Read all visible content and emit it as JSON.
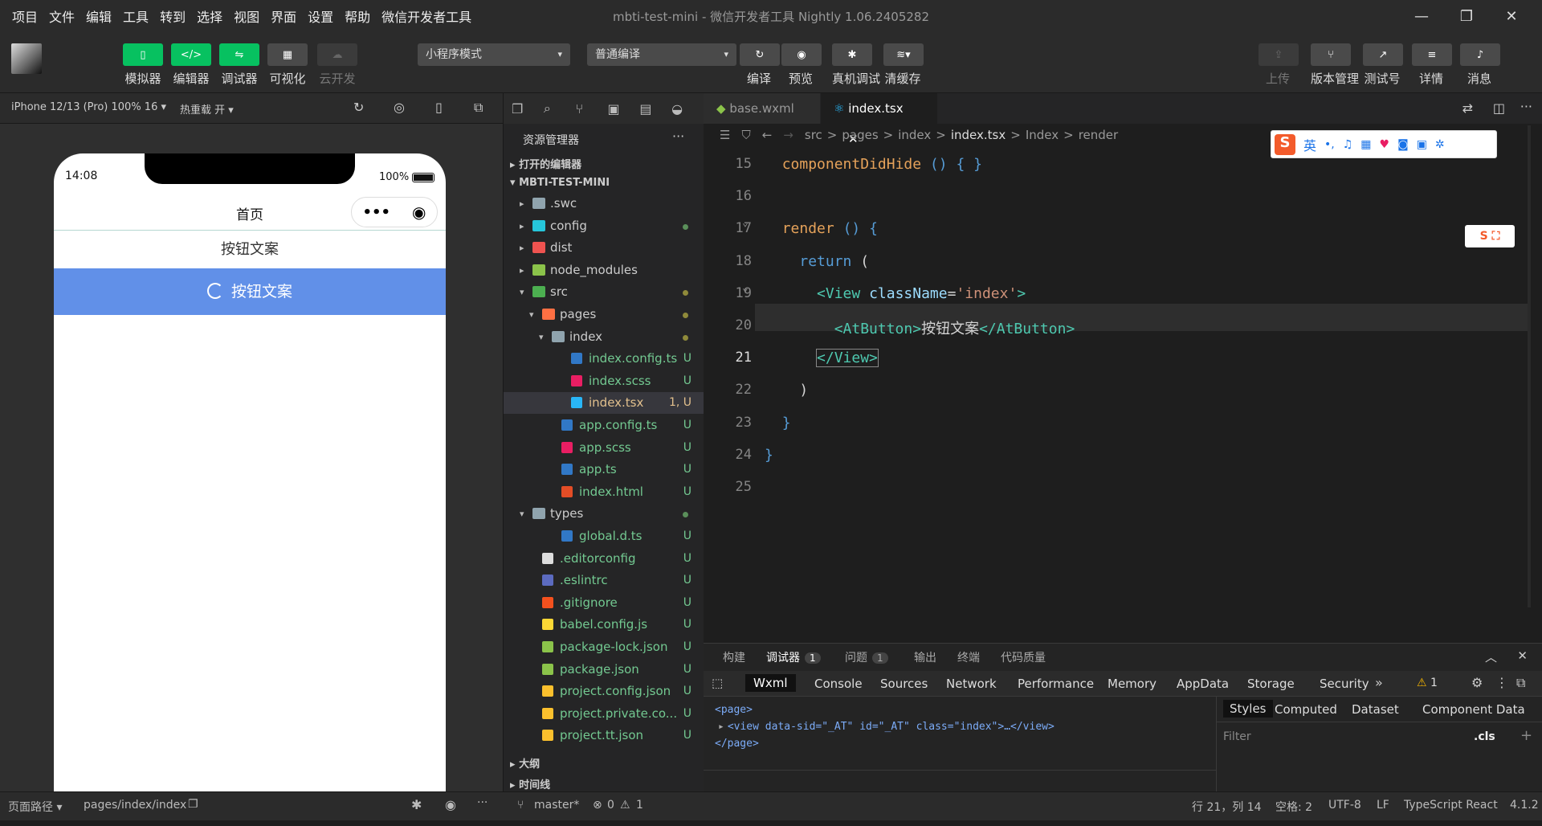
{
  "menu": [
    "项目",
    "文件",
    "编辑",
    "工具",
    "转到",
    "选择",
    "视图",
    "界面",
    "设置",
    "帮助",
    "微信开发者工具"
  ],
  "window_title": "mbti-test-mini - 微信开发者工具 Nightly 1.06.2405282",
  "toolbar": {
    "simulator": "模拟器",
    "editor": "编辑器",
    "debugger": "调试器",
    "visual": "可视化",
    "cloud": "云开发",
    "mode": "小程序模式",
    "compile_mode": "普通编译",
    "compile": "编译",
    "preview": "预览",
    "real_debug": "真机调试",
    "clear_cache": "清缓存",
    "upload": "上传",
    "version": "版本管理",
    "test": "测试号",
    "detail": "详情",
    "message": "消息"
  },
  "sim": {
    "device": "iPhone 12/13 (Pro) 100% 16 ▾",
    "hot_reload": "热重载 开 ▾",
    "time": "14:08",
    "battery": "100%",
    "nav_title": "首页",
    "text_btn": "按钮文案",
    "primary_btn": "按钮文案"
  },
  "explorer": {
    "title": "资源管理器",
    "open_editors": "打开的编辑器",
    "project": "MBTI-TEST-MINI",
    "outline": "大纲",
    "timeline": "时间线",
    "items": [
      {
        "name": ".swc",
        "depth": 1,
        "type": "folder",
        "color": "#90a4ae",
        "status": ""
      },
      {
        "name": "config",
        "depth": 1,
        "type": "folder",
        "color": "#26c6da",
        "status": "dot"
      },
      {
        "name": "dist",
        "depth": 1,
        "type": "folder",
        "color": "#ef5350",
        "status": ""
      },
      {
        "name": "node_modules",
        "depth": 1,
        "type": "folder",
        "color": "#8bc34a",
        "status": ""
      },
      {
        "name": "src",
        "depth": 1,
        "type": "folder",
        "color": "#4caf50",
        "status": "dotw",
        "open": true
      },
      {
        "name": "pages",
        "depth": 2,
        "type": "folder",
        "color": "#ff7043",
        "status": "dotw",
        "open": true
      },
      {
        "name": "index",
        "depth": 3,
        "type": "folder",
        "color": "#90a4ae",
        "status": "dotw",
        "open": true
      },
      {
        "name": "index.config.ts",
        "depth": 4,
        "type": "ts",
        "color": "#3178c6",
        "status": "U"
      },
      {
        "name": "index.scss",
        "depth": 4,
        "type": "scss",
        "color": "#e91e63",
        "status": "U"
      },
      {
        "name": "index.tsx",
        "depth": 4,
        "type": "tsx",
        "color": "#29b6f6",
        "status": "1, U",
        "selected": true
      },
      {
        "name": "app.config.ts",
        "depth": 3,
        "type": "ts",
        "color": "#3178c6",
        "status": "U"
      },
      {
        "name": "app.scss",
        "depth": 3,
        "type": "scss",
        "color": "#e91e63",
        "status": "U"
      },
      {
        "name": "app.ts",
        "depth": 3,
        "type": "ts",
        "color": "#3178c6",
        "status": "U"
      },
      {
        "name": "index.html",
        "depth": 3,
        "type": "html",
        "color": "#e44d26",
        "status": "U"
      },
      {
        "name": "types",
        "depth": 1,
        "type": "folder",
        "color": "#90a4ae",
        "status": "dot",
        "open": true
      },
      {
        "name": "global.d.ts",
        "depth": 3,
        "type": "ts",
        "color": "#3178c6",
        "status": "U"
      },
      {
        "name": ".editorconfig",
        "depth": 1,
        "type": "cfg",
        "color": "#ddd",
        "status": "U"
      },
      {
        "name": ".eslintrc",
        "depth": 1,
        "type": "cfg",
        "color": "#5c6bc0",
        "status": "U"
      },
      {
        "name": ".gitignore",
        "depth": 1,
        "type": "git",
        "color": "#f4511e",
        "status": "U"
      },
      {
        "name": "babel.config.js",
        "depth": 1,
        "type": "js",
        "color": "#fdd835",
        "status": "U"
      },
      {
        "name": "package-lock.json",
        "depth": 1,
        "type": "json",
        "color": "#8bc34a",
        "status": "U"
      },
      {
        "name": "package.json",
        "depth": 1,
        "type": "json",
        "color": "#8bc34a",
        "status": "U"
      },
      {
        "name": "project.config.json",
        "depth": 1,
        "type": "json",
        "color": "#fbc02d",
        "status": "U"
      },
      {
        "name": "project.private.co...",
        "depth": 1,
        "type": "json",
        "color": "#fbc02d",
        "status": "U"
      },
      {
        "name": "project.tt.json",
        "depth": 1,
        "type": "json",
        "color": "#fbc02d",
        "status": "U"
      }
    ]
  },
  "editor": {
    "tabs": [
      "base.wxml",
      "index.tsx"
    ],
    "breadcrumb": [
      "src",
      "pages",
      "index",
      "index.tsx",
      "Index",
      "render"
    ],
    "lines": [
      {
        "n": "15",
        "html": "  <span style='color:#e5a25a'>componentDidHide</span> <span style='color:#569cd6'>()</span> <span style='color:#569cd6'>{ }</span>"
      },
      {
        "n": "16",
        "html": ""
      },
      {
        "n": "17",
        "html": "  <span style='color:#e5a25a'>render</span> <span style='color:#569cd6'>()</span> <span style='color:#569cd6'>{</span>"
      },
      {
        "n": "18",
        "html": "    <span style='color:#569cd6'>return</span> <span style='color:#d4d4d4'>(</span>"
      },
      {
        "n": "19",
        "html": "      <span style='color:#4ec9b0'>&lt;View</span> <span style='color:#9cdcfe'>className</span><span style='color:#d4d4d4'>=</span><span style='color:#ce9178'>'index'</span><span style='color:#4ec9b0'>&gt;</span>"
      },
      {
        "n": "20",
        "html": "        <span style='color:#4ec9b0'>&lt;AtButton&gt;</span><span style='color:#d4d4d4'>按钮文案</span><span style='color:#4ec9b0'>&lt;/AtButton&gt;</span>"
      },
      {
        "n": "21",
        "html": "      <span style='color:#4ec9b0;outline:1px solid #888'>&lt;/View&gt;</span>"
      },
      {
        "n": "22",
        "html": "    <span style='color:#d4d4d4'>)</span>"
      },
      {
        "n": "23",
        "html": "  <span style='color:#569cd6'>}</span>"
      },
      {
        "n": "24",
        "html": "<span style='color:#569cd6'>}</span>"
      },
      {
        "n": "25",
        "html": ""
      }
    ]
  },
  "panel": {
    "tabs": [
      "构建",
      "调试器",
      "问题",
      "输出",
      "终端",
      "代码质量"
    ],
    "debug_count": "1",
    "issue_count": "1",
    "devtabs": [
      "Wxml",
      "Console",
      "Sources",
      "Network",
      "Performance",
      "Memory",
      "AppData",
      "Storage",
      "Security"
    ],
    "warn": "1",
    "wxml": [
      "<page>",
      "<view data-sid=\"_AT\" id=\"_AT\" class=\"index\">…</view>",
      "</page>"
    ],
    "style_tabs": [
      "Styles",
      "Computed",
      "Dataset",
      "Component Data"
    ],
    "filter": "Filter",
    "cls": ".cls"
  },
  "status": {
    "page_path": "页面路径 ▾",
    "path": "pages/index/index",
    "branch": "master*",
    "errors": "0",
    "warnings": "1",
    "pos": "行 21，列 14",
    "spaces": "空格: 2",
    "enc": "UTF-8",
    "eol": "LF",
    "lang": "TypeScript React",
    "ver": "4.1.2"
  }
}
